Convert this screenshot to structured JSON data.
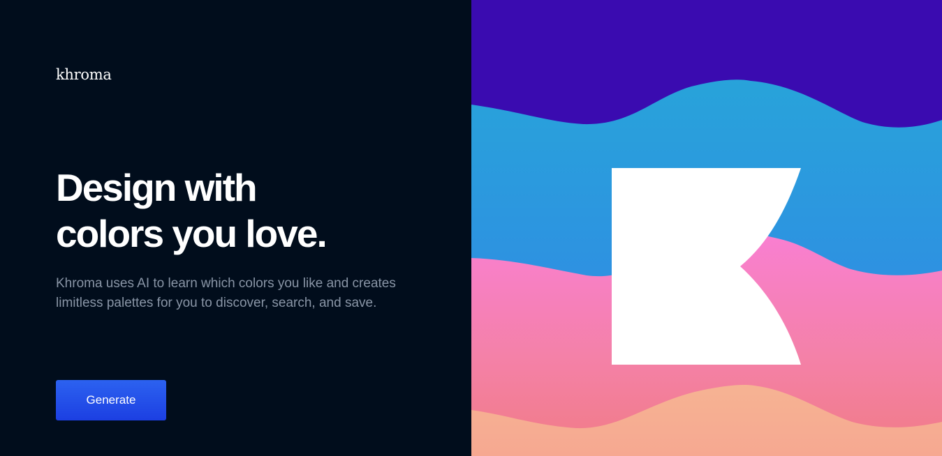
{
  "brand": {
    "logo_text": "khroma"
  },
  "hero": {
    "headline_line1": "Design with",
    "headline_line2": "colors you love.",
    "description": "Khroma uses AI to learn which colors you like and creates limitless palettes for you to discover, search, and save.",
    "cta_label": "Generate"
  },
  "colors": {
    "background": "#010d1c",
    "button": "#1c3fe2",
    "band_purple": "#3a0cb0",
    "band_blue": "#2aa0dd",
    "band_pink": "#f77fd0",
    "band_peach": "#f6b091",
    "logo_mark": "#ffffff"
  },
  "art": {
    "logo_mark": "k-mark-icon"
  }
}
